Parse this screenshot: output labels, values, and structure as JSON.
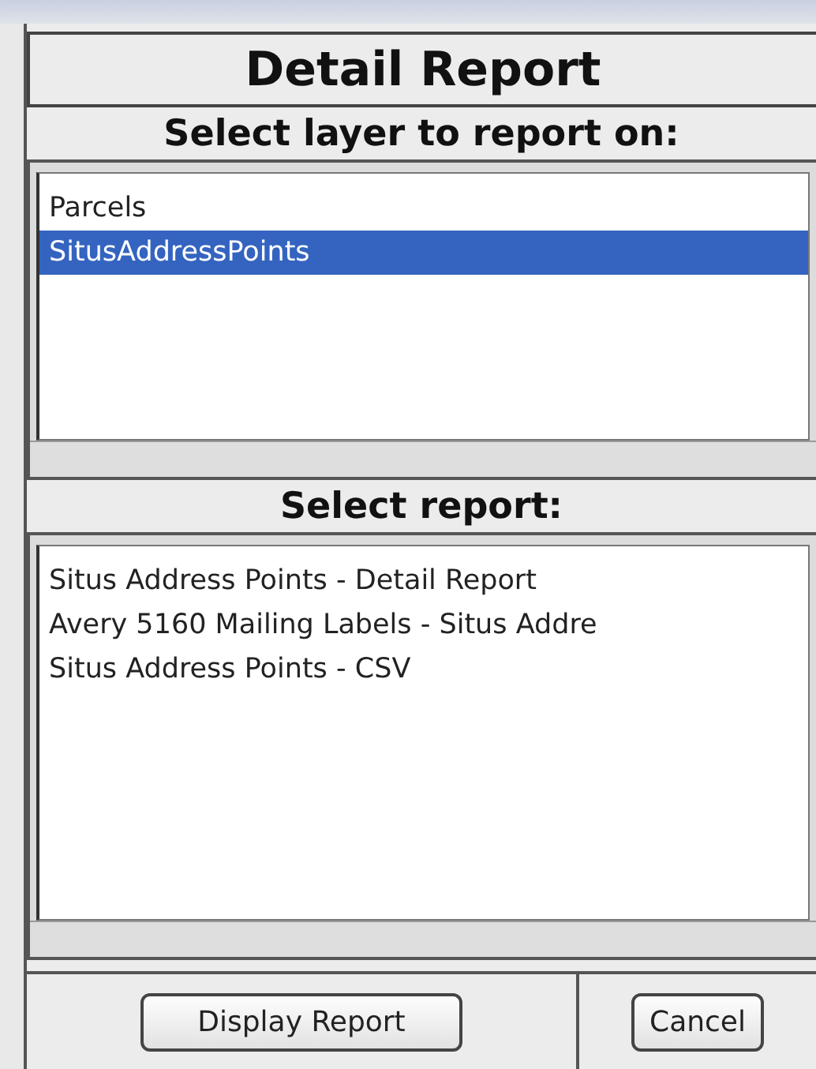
{
  "title": "Detail Report",
  "layer_section": {
    "heading": "Select layer to report on:",
    "items": [
      {
        "label": "Parcels",
        "selected": false
      },
      {
        "label": "SitusAddressPoints",
        "selected": true
      }
    ]
  },
  "report_section": {
    "heading": "Select report:",
    "items": [
      {
        "label": "Situs Address Points - Detail Report",
        "selected": false
      },
      {
        "label": "Avery 5160 Mailing Labels - Situs Addre",
        "selected": false
      },
      {
        "label": "Situs Address Points - CSV",
        "selected": false
      }
    ]
  },
  "buttons": [
    {
      "label": "Display Report"
    },
    {
      "label": "Cancel"
    }
  ]
}
